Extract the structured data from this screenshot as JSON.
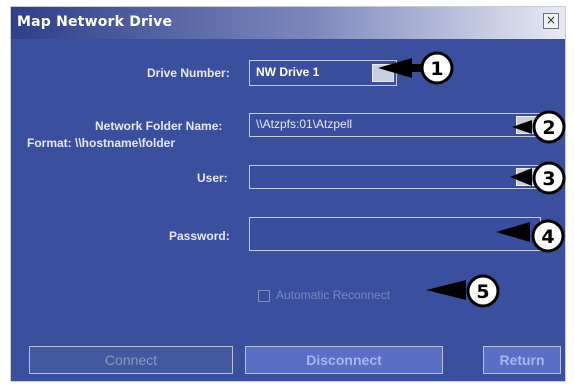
{
  "window": {
    "title": "Map Network Drive",
    "close_glyph": "×"
  },
  "form": {
    "drive_number_label": "Drive Number:",
    "drive_number_value": "NW Drive 1",
    "network_folder_label": "Network Folder Name:",
    "network_folder_format": "Format: \\\\hostname\\folder",
    "network_folder_value": "\\\\Atzpfs:01\\Atzpell",
    "user_label": "User:",
    "user_value": "",
    "password_label": "Password:",
    "password_value": "",
    "auto_reconnect_label": "Automatic Reconnect",
    "auto_reconnect_checked": false
  },
  "buttons": {
    "connect": "Connect",
    "disconnect": "Disconnect",
    "return": "Return"
  },
  "callouts": [
    "1",
    "2",
    "3",
    "4",
    "5"
  ],
  "colors": {
    "dialog_bg": "#3b4f9f",
    "field_border": "#c6cbe0",
    "label_text": "#e4e7f4"
  }
}
